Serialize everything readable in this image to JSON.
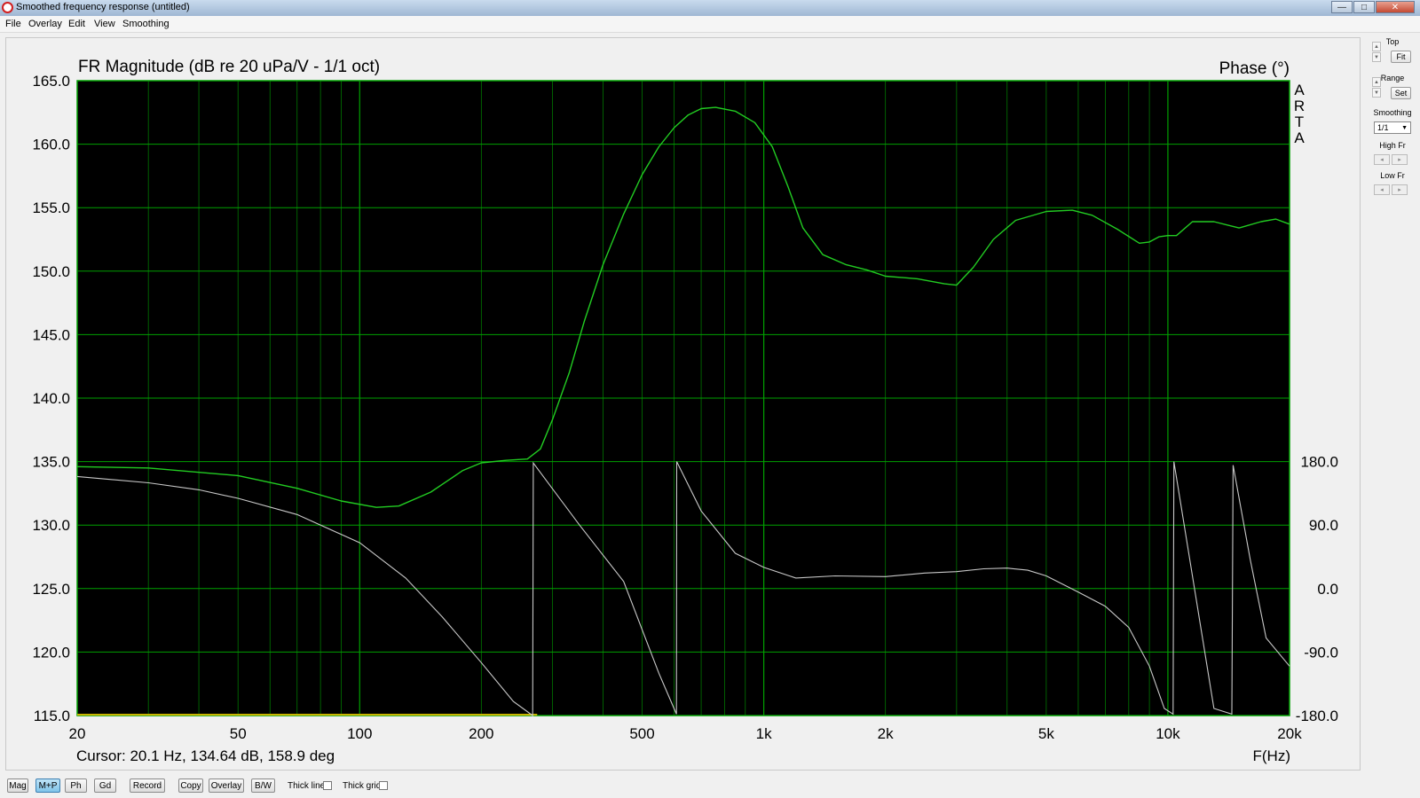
{
  "window": {
    "title": "Smoothed frequency response (untitled)",
    "minimize": "—",
    "maximize": "□",
    "close": "✕"
  },
  "menu": [
    "File",
    "Overlay",
    "Edit",
    "View",
    "Smoothing"
  ],
  "colors": {
    "plot_bg": "#000000",
    "grid": "#00a000",
    "magnitude": "#22cc22",
    "phase": "#c8c8c8",
    "baseline": "#c8b400"
  },
  "chart_data": {
    "type": "line",
    "title": "FR Magnitude (dB re 20 uPa/V - 1/1 oct)",
    "right_title": "Phase (°)",
    "watermark": [
      "A",
      "R",
      "T",
      "A"
    ],
    "xlabel": "F(Hz)",
    "xscale": "log",
    "xlim": [
      20,
      20000
    ],
    "x_ticks": [
      {
        "v": 20,
        "label": "20"
      },
      {
        "v": 50,
        "label": "50"
      },
      {
        "v": 100,
        "label": "100"
      },
      {
        "v": 200,
        "label": "200"
      },
      {
        "v": 500,
        "label": "500"
      },
      {
        "v": 1000,
        "label": "1k"
      },
      {
        "v": 2000,
        "label": "2k"
      },
      {
        "v": 5000,
        "label": "5k"
      },
      {
        "v": 10000,
        "label": "10k"
      },
      {
        "v": 20000,
        "label": "20k"
      }
    ],
    "ylim": [
      115,
      165
    ],
    "y_ticks": [
      "115.0",
      "120.0",
      "125.0",
      "130.0",
      "135.0",
      "140.0",
      "145.0",
      "150.0",
      "155.0",
      "160.0",
      "165.0"
    ],
    "y2lim": [
      -180,
      180
    ],
    "y2_domain_bottom_db": 115,
    "y2_domain_top_db": 135,
    "y2_ticks": [
      "-180.0",
      "-90.0",
      "0.0",
      "90.0",
      "180.0"
    ],
    "grid": true,
    "cursor_readout": "Cursor: 20.1 Hz, 134.64 dB, 158.9 deg",
    "series": [
      {
        "name": "Magnitude",
        "axis": "left",
        "x": [
          20,
          30,
          50,
          70,
          90,
          110,
          125,
          150,
          180,
          200,
          230,
          260,
          280,
          300,
          330,
          360,
          400,
          450,
          500,
          550,
          600,
          650,
          700,
          760,
          850,
          950,
          1050,
          1150,
          1250,
          1400,
          1600,
          1800,
          2000,
          2400,
          2800,
          3000,
          3300,
          3700,
          4200,
          5000,
          5800,
          6500,
          7500,
          8500,
          9000,
          9500,
          10000,
          10500,
          11500,
          13000,
          15000,
          17000,
          18500,
          20000
        ],
        "values": [
          134.6,
          134.5,
          133.9,
          132.9,
          131.9,
          131.4,
          131.5,
          132.6,
          134.3,
          134.9,
          135.1,
          135.2,
          136.0,
          138.3,
          142.0,
          146.1,
          150.5,
          154.5,
          157.6,
          159.8,
          161.3,
          162.3,
          162.8,
          162.9,
          162.6,
          161.7,
          159.8,
          156.6,
          153.4,
          151.3,
          150.5,
          150.1,
          149.6,
          149.4,
          149.0,
          148.9,
          150.3,
          152.5,
          154.0,
          154.7,
          154.8,
          154.4,
          153.3,
          152.2,
          152.3,
          152.7,
          152.8,
          152.8,
          153.9,
          153.9,
          153.4,
          153.9,
          154.1,
          153.7
        ]
      },
      {
        "name": "Phase",
        "axis": "right",
        "x": [
          20,
          30,
          40,
          50,
          70,
          100,
          130,
          160,
          200,
          240,
          268,
          269,
          350,
          450,
          550,
          608,
          609,
          700,
          850,
          1000,
          1200,
          1500,
          2000,
          2500,
          3000,
          3500,
          4000,
          4500,
          5000,
          6000,
          7000,
          8000,
          9000,
          9800,
          10300,
          10350,
          13000,
          14400,
          14500,
          16000,
          17500,
          20000
        ],
        "values": [
          158.9,
          150,
          140,
          128,
          105,
          65,
          15,
          -40,
          -105,
          -160,
          -180,
          178,
          90,
          10,
          -120,
          -178,
          180,
          110,
          50,
          30,
          15,
          18,
          17,
          22,
          24,
          28,
          29,
          26,
          18,
          -5,
          -25,
          -55,
          -110,
          -170,
          -178,
          180,
          -170,
          -178,
          175,
          40,
          -70,
          -110
        ]
      }
    ],
    "baseline": {
      "name": "Baseline",
      "x": [
        20,
        275
      ],
      "value": 115
    }
  },
  "side_panel": {
    "top_label": "Top",
    "fit_button": "Fit",
    "range_label": "Range",
    "set_button": "Set",
    "smoothing_label": "Smoothing",
    "smoothing_value": "1/1",
    "high_fr_label": "High Fr",
    "low_fr_label": "Low Fr",
    "up_glyph": "▲",
    "down_glyph": "▼",
    "left_glyph": "◂",
    "right_glyph": "▸",
    "dropdown_glyph": "▼"
  },
  "bottom_bar": {
    "mag": "Mag",
    "mp": "M+P",
    "ph": "Ph",
    "gd": "Gd",
    "record": "Record",
    "copy": "Copy",
    "overlay": "Overlay",
    "bw": "B/W",
    "thick_line": "Thick line",
    "thick_grid": "Thick grid"
  }
}
